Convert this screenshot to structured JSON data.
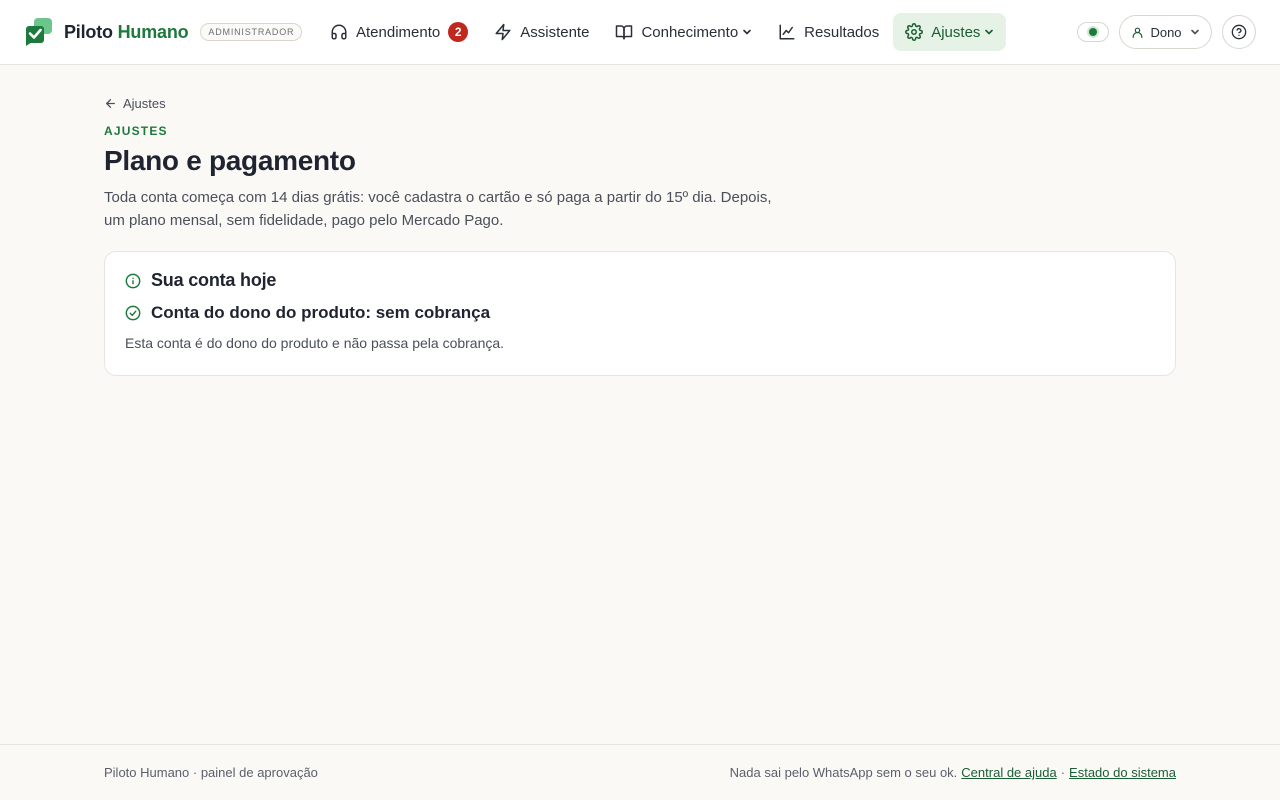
{
  "brand": {
    "name_primary": "Piloto",
    "name_accent": "Humano",
    "role_badge": "ADMINISTRADOR"
  },
  "nav": {
    "items": [
      {
        "label": "Atendimento",
        "icon": "headset-icon",
        "badge": "2"
      },
      {
        "label": "Assistente",
        "icon": "lightning-icon"
      },
      {
        "label": "Conhecimento",
        "icon": "book-icon"
      },
      {
        "label": "Resultados",
        "icon": "chart-line-icon"
      },
      {
        "label": "Ajustes",
        "icon": "gear-icon",
        "active": true
      }
    ]
  },
  "header_right": {
    "user_label": "Dono",
    "status_color": "#1e7a3c"
  },
  "main": {
    "back_label": "Ajustes",
    "eyebrow": "AJUSTES",
    "title": "Plano e pagamento",
    "description": "Toda conta começa com 14 dias grátis: você cadastra o cartão e só paga a partir do 15º dia. Depois, um plano mensal, sem fidelidade, pago pelo Mercado Pago."
  },
  "card": {
    "title": "Sua conta hoje",
    "status": "Conta do dono do produto: sem cobrança",
    "note": "Esta conta é do dono do produto e não passa pela cobrança."
  },
  "footer": {
    "left": "Piloto Humano · painel de aprovação",
    "right_text": "Nada sai pelo WhatsApp sem o seu ok.",
    "help_link": "Central de ajuda",
    "separator": "·",
    "status_link": "Estado do sistema"
  },
  "colors": {
    "accent": "#1e7a3c",
    "badge_red": "#c0271d",
    "active_nav_bg": "#e6f2e6"
  }
}
